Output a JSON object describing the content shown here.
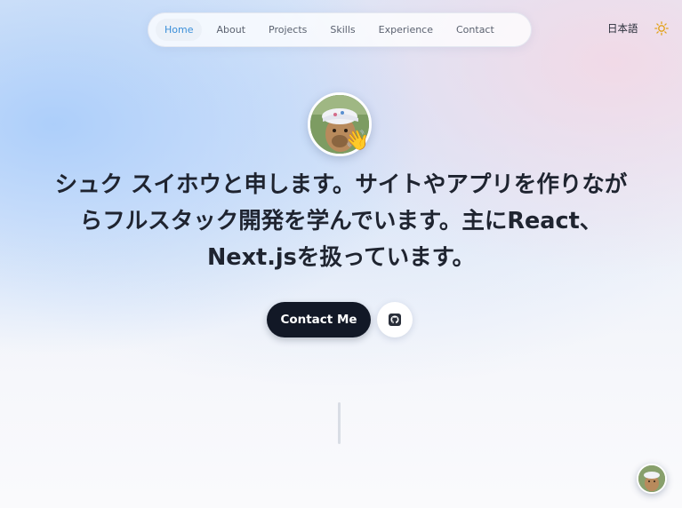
{
  "nav": {
    "items": [
      {
        "label": "Home",
        "active": true
      },
      {
        "label": "About",
        "active": false
      },
      {
        "label": "Projects",
        "active": false
      },
      {
        "label": "Skills",
        "active": false
      },
      {
        "label": "Experience",
        "active": false
      },
      {
        "label": "Contact",
        "active": false
      }
    ]
  },
  "header": {
    "language_label": "日本語",
    "theme_icon": "sun-icon"
  },
  "hero": {
    "avatar_icon": "profile-photo",
    "wave_emoji": "👋",
    "headline_strong": "シュク スイホウと申します。",
    "headline_rest": "サイトやアプリを作りながらフルスタック開発を学んでいます。主にReact、Next.jsを扱っています。",
    "contact_label": "Contact Me",
    "github_icon": "github-icon"
  },
  "colors": {
    "accent": "#3b8fd9",
    "button_dark": "#121826",
    "text": "#1f2430"
  }
}
